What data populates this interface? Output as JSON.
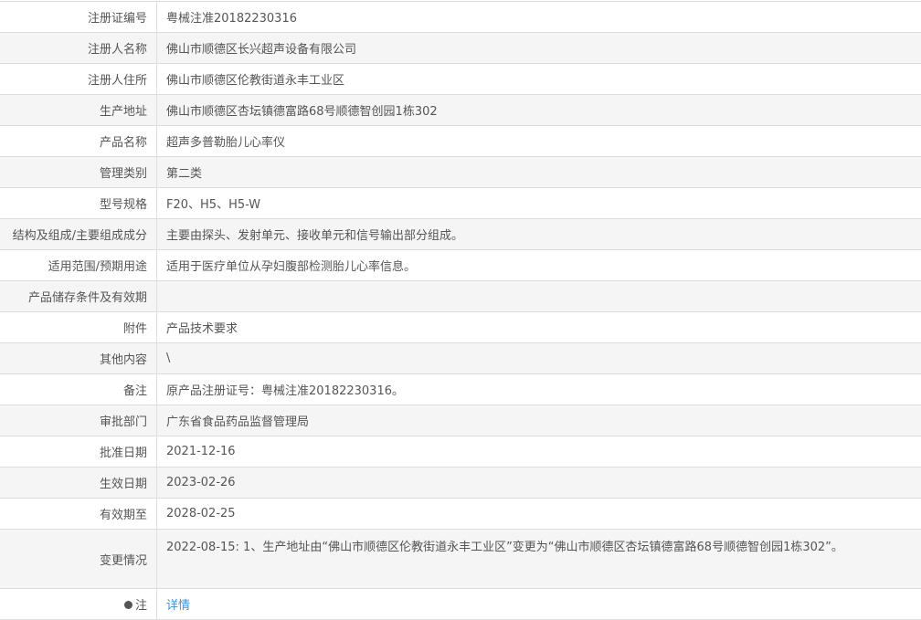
{
  "rows": [
    {
      "label": "注册证编号",
      "value": "粤械注准20182230316"
    },
    {
      "label": "注册人名称",
      "value": "佛山市顺德区长兴超声设备有限公司"
    },
    {
      "label": "注册人住所",
      "value": "佛山市顺德区伦教街道永丰工业区"
    },
    {
      "label": "生产地址",
      "value": "佛山市顺德区杏坛镇德富路68号顺德智创园1栋302"
    },
    {
      "label": "产品名称",
      "value": "超声多普勒胎儿心率仪"
    },
    {
      "label": "管理类别",
      "value": "第二类"
    },
    {
      "label": "型号规格",
      "value": "F20、H5、H5-W"
    },
    {
      "label": "结构及组成/主要组成成分",
      "value": "主要由探头、发射单元、接收单元和信号输出部分组成。"
    },
    {
      "label": "适用范围/预期用途",
      "value": "适用于医疗单位从孕妇腹部检测胎儿心率信息。"
    },
    {
      "label": "产品储存条件及有效期",
      "value": ""
    },
    {
      "label": "附件",
      "value": "产品技术要求"
    },
    {
      "label": "其他内容",
      "value": "\\"
    },
    {
      "label": "备注",
      "value": "原产品注册证号：粤械注准20182230316。"
    },
    {
      "label": "审批部门",
      "value": "广东省食品药品监督管理局"
    },
    {
      "label": "批准日期",
      "value": "2021-12-16"
    },
    {
      "label": "生效日期",
      "value": "2023-02-26"
    },
    {
      "label": "有效期至",
      "value": "2028-02-25"
    },
    {
      "label": "变更情况",
      "value": "2022-08-15: 1、生产地址由“佛山市顺德区伦教街道永丰工业区”变更为“佛山市顺德区杏坛镇德富路68号顺德智创园1栋302”。"
    }
  ],
  "note": {
    "label": "注",
    "link": "详情"
  }
}
